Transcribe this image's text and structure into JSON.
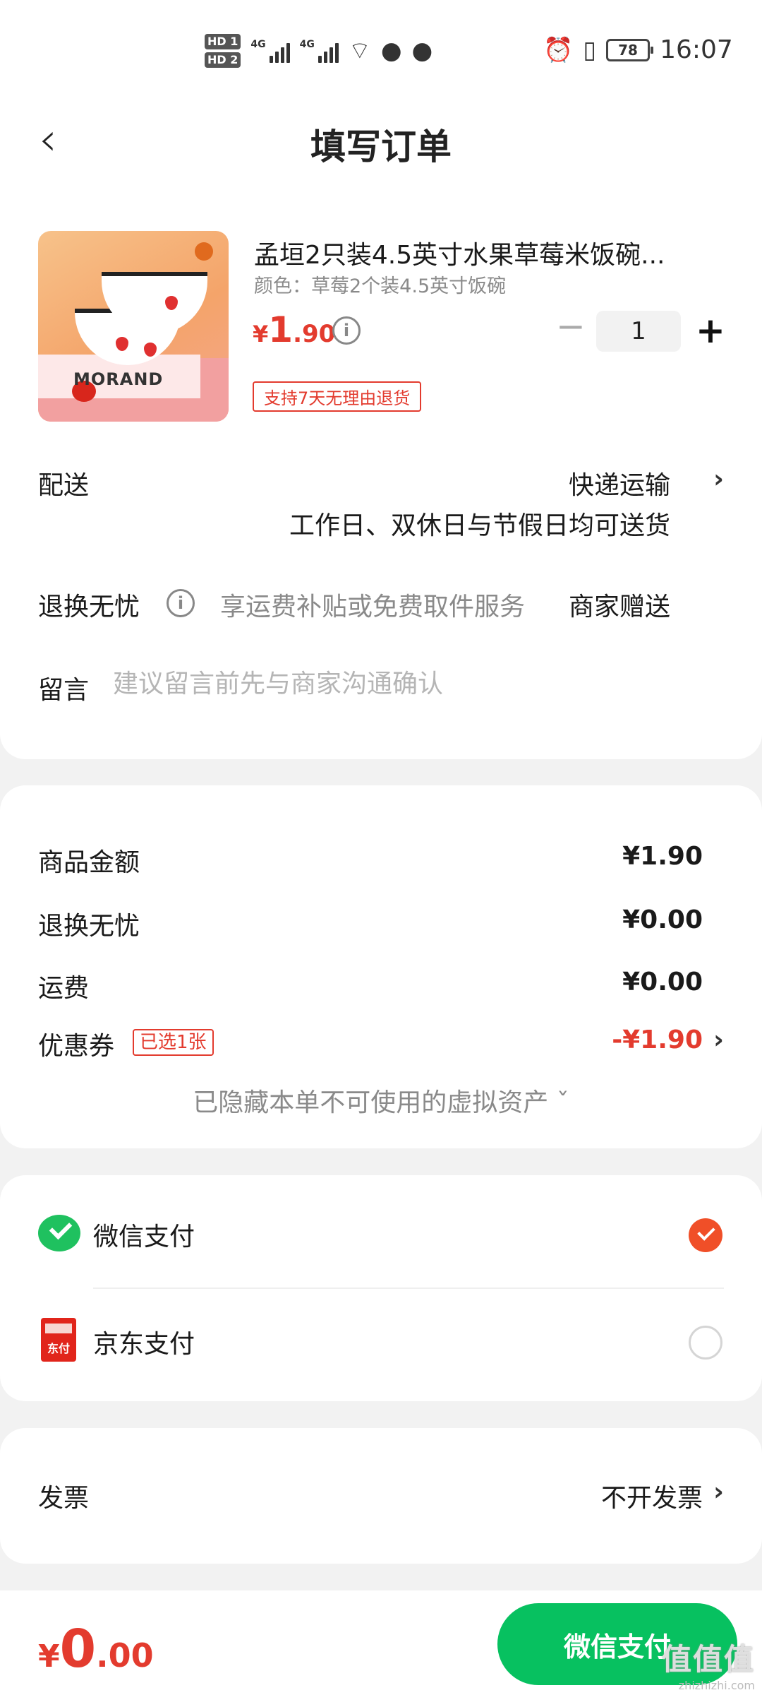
{
  "status_bar": {
    "hd1": "HD 1",
    "hd2": "HD 2",
    "network1": "4G",
    "network2": "4G",
    "battery": "78",
    "time": "16:07"
  },
  "header": {
    "back_icon": "chevron-left-icon",
    "title": "填写订单"
  },
  "product": {
    "name": "孟垣2只装4.5英寸水果草莓米饭碗...",
    "spec": "颜色：草莓2个装4.5英寸饭碗",
    "price_currency": "¥",
    "price_int": "1",
    "price_dec": ".90",
    "info_icon_char": "i",
    "qty_minus": "−",
    "quantity": "1",
    "qty_plus": "+",
    "return_tag": "支持7天无理由退货",
    "image_brand_text": "MORAND"
  },
  "delivery": {
    "label": "配送",
    "value": "快递运输",
    "note": "工作日、双休日与节假日均可送货"
  },
  "return_service": {
    "label": "退换无忧",
    "info_icon_char": "i",
    "desc": "享运费补贴或免费取件服务",
    "value": "商家赠送"
  },
  "message": {
    "label": "留言",
    "placeholder": "建议留言前先与商家沟通确认",
    "value": ""
  },
  "fees": {
    "goods_label": "商品金额",
    "goods_value": "¥1.90",
    "return_label": "退换无忧",
    "return_value": "¥0.00",
    "shipping_label": "运费",
    "shipping_value": "¥0.00",
    "coupon_label": "优惠券",
    "coupon_tag": "已选1张",
    "coupon_value": "-¥1.90",
    "hidden_assets": "已隐藏本单不可使用的虚拟资产 ˇ"
  },
  "payment": {
    "wechat_label": "微信支付",
    "wechat_selected": true,
    "jd_label": "京东支付",
    "jd_icon_text": "东付",
    "jd_selected": false
  },
  "invoice": {
    "label": "发票",
    "value": "不开发票"
  },
  "chevron": "›",
  "bottom": {
    "total_currency": "¥",
    "total_int": "0",
    "total_dec": ".00",
    "pay_button": "微信支付",
    "watermark": "值值值",
    "watermark_url": "zhizhizhi.com"
  },
  "colors": {
    "accent_red": "#e33b2e",
    "wechat_green": "#07c160",
    "radio_selected": "#f04f28"
  }
}
